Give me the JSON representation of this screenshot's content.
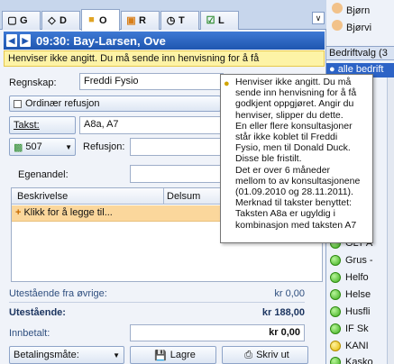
{
  "tabs": [
    {
      "label": "G",
      "icon": "tooth-icon"
    },
    {
      "label": "D",
      "icon": "diamond-icon"
    },
    {
      "label": "O",
      "icon": "folder-icon"
    },
    {
      "label": "R",
      "icon": "receipt-icon"
    },
    {
      "label": "T",
      "icon": "clock-icon"
    },
    {
      "label": "L",
      "icon": "checklist-icon"
    }
  ],
  "header": {
    "title": "09:30: Bay-Larsen, Ove"
  },
  "warning": "Henviser ikke angitt. Du må sende inn henvisning for å få",
  "form": {
    "regnskap_label": "Regnskap:",
    "regnskap_value": "Freddi Fysio",
    "ordinaer_button": "Ordinær refusjon",
    "takst_button": "Takst:",
    "takst_value": "A8a, A7",
    "code_button": "507",
    "refusjon_label": "Refusjon:",
    "egenandel_label": "Egenandel:"
  },
  "grid": {
    "columns": [
      "Beskrivelse",
      "Delsum"
    ],
    "add_row": "Klikk for å legge til..."
  },
  "summary": {
    "utestaende_ovrige_label": "Utestående fra øvrige:",
    "utestaende_ovrige_value": "kr 0,00",
    "utestaende_label": "Utestående:",
    "utestaende_value": "kr 188,00",
    "innbetalt_label": "Innbetalt:",
    "innbetalt_value": "kr 0,00"
  },
  "buttons": {
    "betalingsmate": "Betalingsmåte:",
    "lagre": "Lagre",
    "skriv_ut": "Skriv ut"
  },
  "tooltip": [
    "Henviser ikke angitt. Du må",
    "sende inn henvisning for å få",
    "godkjent oppgjøret. Angir du",
    "henviser, slipper du dette.",
    "En eller flere konsultasjoner",
    "står ikke koblet til Freddi",
    "Fysio, men til Donald Duck.",
    "Disse ble fristilt.",
    "Det er over 6 måneder",
    "mellom to av konsultasjonene",
    "(01.09.2010 og 28.11.2011).",
    "Merknad til takster benyttet:",
    "Taksten A8a er ugyldig i",
    "kombinasjon med taksten A7"
  ],
  "right": {
    "top_items": [
      "Bjørn",
      "Bjørvi"
    ],
    "bedrift_header": "Bedriftvalg (3",
    "bedrift_all": "alle bedrift",
    "items": [
      {
        "label": "GLT A",
        "status": "green"
      },
      {
        "label": "Grus -",
        "status": "green"
      },
      {
        "label": "Helfo",
        "status": "green"
      },
      {
        "label": "Helse",
        "status": "green"
      },
      {
        "label": "Husfli",
        "status": "green"
      },
      {
        "label": "IF Sk",
        "status": "green"
      },
      {
        "label": "KANI",
        "status": "yellow"
      },
      {
        "label": "Kasko",
        "status": "green"
      }
    ]
  }
}
